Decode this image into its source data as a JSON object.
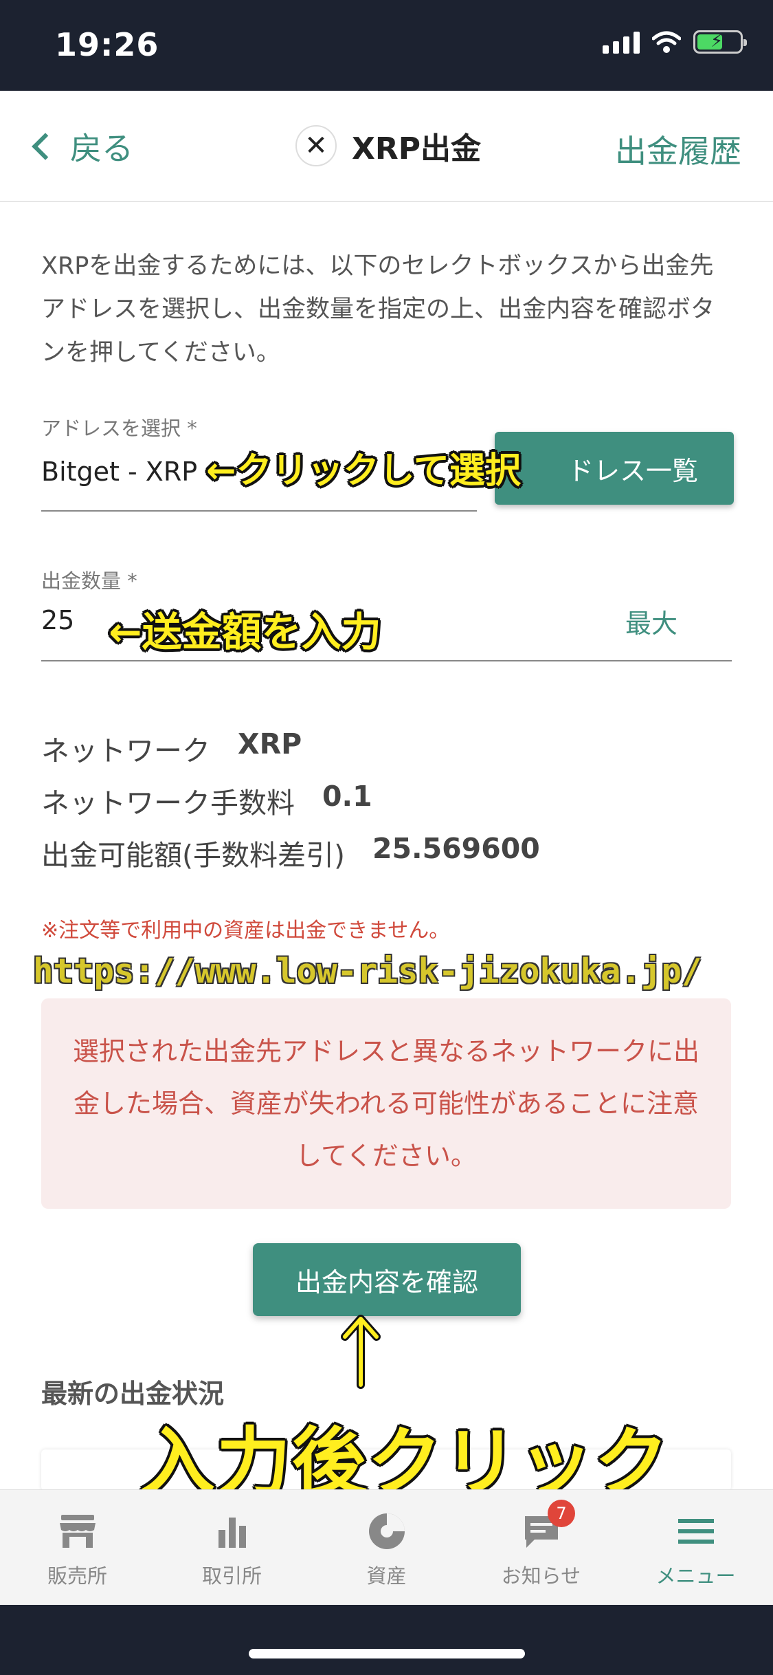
{
  "status_bar": {
    "time": "19:26"
  },
  "nav": {
    "back_label": "戻る",
    "title": "XRP出金",
    "history_label": "出金履歴"
  },
  "intro_text": "XRPを出金するためには、以下のセレクトボックスから出金先アドレスを選択し、出金数量を指定の上、出金内容を確認ボタンを押してください。",
  "address_field": {
    "label": "アドレスを選択 *",
    "value": "Bitget - XRP",
    "list_button_label": "ドレス一覧"
  },
  "amount_field": {
    "label": "出金数量 *",
    "value": "25",
    "max_label": "最大"
  },
  "details": [
    {
      "label": "ネットワーク",
      "value": "XRP"
    },
    {
      "label": "ネットワーク手数料",
      "value": "0.1"
    },
    {
      "label": "出金可能額(手数料差引)",
      "value": "25.569600"
    }
  ],
  "warning_note": "※注文等で利用中の資産は出金できません。",
  "alert_text": "選択された出金先アドレスと異なるネットワークに出金した場合、資産が失われる可能性があることに注意してください。",
  "confirm_button_label": "出金内容を確認",
  "latest_status_title": "最新の出金状況",
  "annotations": {
    "select": "←クリックして選択",
    "amount": "←送金額を入力",
    "click": "入力後クリック",
    "watermark": "https://www.low-risk-jizokuka.jp/"
  },
  "tabbar": {
    "items": [
      {
        "label": "販売所",
        "icon": "store-icon"
      },
      {
        "label": "取引所",
        "icon": "bar-chart-icon"
      },
      {
        "label": "資産",
        "icon": "pie-chart-icon"
      },
      {
        "label": "お知らせ",
        "icon": "message-icon",
        "badge": "7"
      },
      {
        "label": "メニュー",
        "icon": "menu-icon",
        "active": true
      }
    ]
  },
  "colors": {
    "accent": "#3f8f7f",
    "warning": "#d04a3c",
    "alert_bg": "#f9ecec",
    "annotation": "#ffee1f"
  }
}
